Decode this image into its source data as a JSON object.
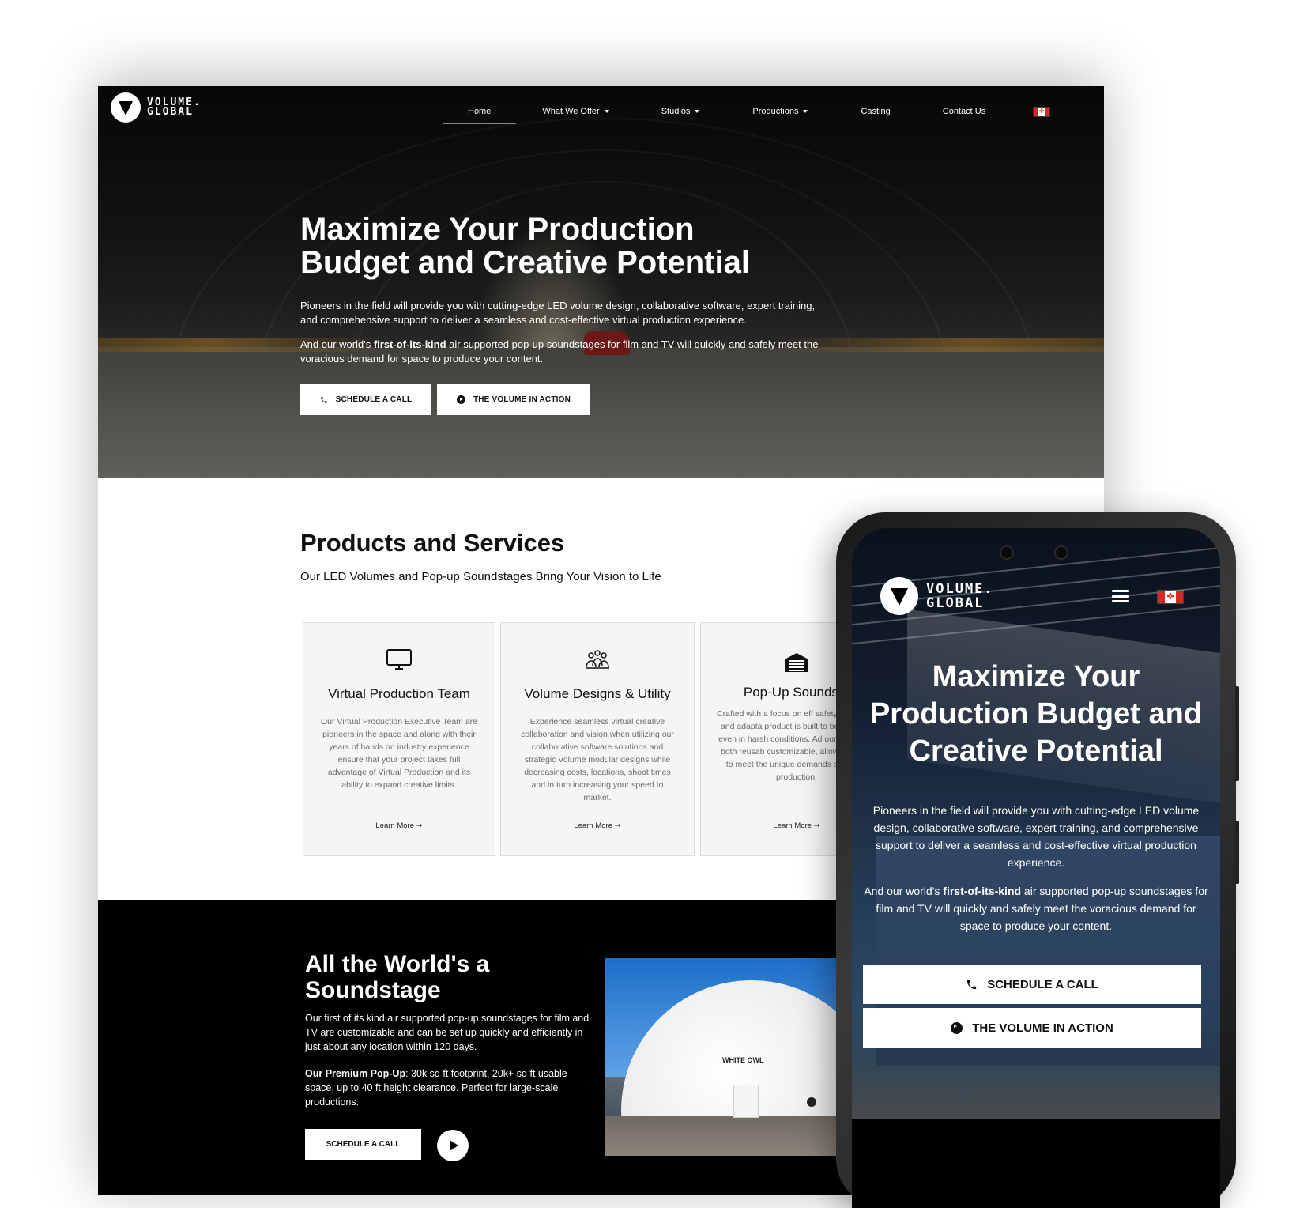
{
  "brand": {
    "name_line1": "VOLUME.",
    "name_line2": "GLOBAL"
  },
  "nav": {
    "items": [
      {
        "label": "Home",
        "dropdown": false,
        "active": true
      },
      {
        "label": "What We Offer",
        "dropdown": true
      },
      {
        "label": "Studios",
        "dropdown": true
      },
      {
        "label": "Productions",
        "dropdown": true
      },
      {
        "label": "Casting",
        "dropdown": false
      },
      {
        "label": "Contact Us",
        "dropdown": false
      }
    ],
    "flag_icon": "canada-flag-icon"
  },
  "hero": {
    "title": "Maximize Your Production Budget and Creative Potential",
    "paragraph1": "Pioneers in the field will provide you with cutting-edge LED volume design, collaborative software, expert training, and comprehensive support to deliver a seamless and cost-effective virtual production experience.",
    "paragraph2_prefix": "And our world's ",
    "paragraph2_bold": "first-of-its-kind",
    "paragraph2_suffix": " air supported pop-up soundstages for film and TV will quickly and safely meet the voracious demand for space to produce your content.",
    "btn_call": "SCHEDULE A CALL",
    "btn_volume": "THE VOLUME IN ACTION"
  },
  "products": {
    "title": "Products and Services",
    "subtitle": "Our LED Volumes and Pop-up Soundstages Bring Your Vision to Life",
    "cards": [
      {
        "icon": "monitor-icon",
        "title": "Virtual Production Team",
        "desc": "Our Virtual Production Executive Team are pioneers in the space and along with their years of hands on industry experience ensure that your project takes full advantage of Virtual Production and its ability to expand creative limits.",
        "link": "Learn More ➞"
      },
      {
        "icon": "team-icon",
        "title": "Volume Designs & Utility",
        "desc": "Experience seamless virtual creative collaboration and vision when utilizing our collaborative software solutions and strategic Volume modular designs  while decreasing costs, locations, shoot times and in turn increasing your speed to market.",
        "link": "Learn More ➞"
      },
      {
        "icon": "warehouse-icon",
        "title": "Pop-Up Soundsta",
        "desc": "Crafted with a focus on eff safety, durability, and adapta product is built to be rapidly d even in harsh conditions. Ad our offering is both reusab customizable, allowing it to b to meet the unique demands o and TV production.",
        "link": "Learn More ➞"
      }
    ]
  },
  "soundstage": {
    "title": "All the World's a Soundstage",
    "paragraph1": "Our first of its kind air supported pop-up soundstages for film and TV are customizable and can be set up quickly and efficiently in just about any location within 120 days.",
    "paragraph2_bold": "Our Premium Pop-Up",
    "paragraph2_rest": ": 30k sq ft footprint, 20k+ sq ft usable space, up to 40 ft height clearance. Perfect for large-scale productions.",
    "btn_call": "SCHEDULE A CALL",
    "photo_label": "WHITE OWL"
  },
  "mobile": {
    "title": "Maximize Your Production Budget and Creative Potential",
    "paragraph1": "Pioneers in the field will provide you with cutting-edge LED volume design, collaborative software, expert training, and comprehensive support to deliver a seamless and cost-effective virtual production experience.",
    "paragraph2_prefix": "And our world's ",
    "paragraph2_bold": "first-of-its-kind",
    "paragraph2_suffix": " air supported pop-up soundstages for film and TV will quickly and safely meet the voracious demand for space to produce your content.",
    "btn_call": "SCHEDULE A CALL",
    "btn_volume": "THE VOLUME IN ACTION",
    "menu_icon": "hamburger-menu-icon"
  }
}
